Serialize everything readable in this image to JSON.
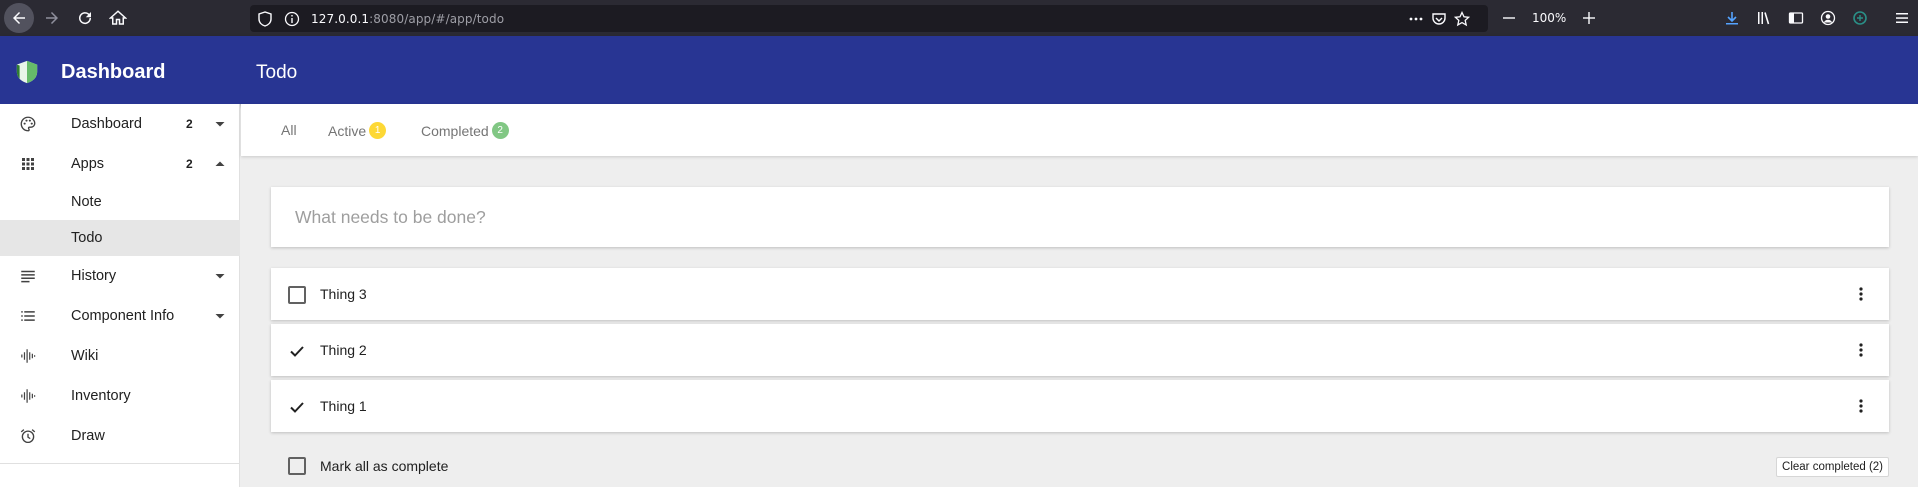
{
  "browser": {
    "url_host": "127.0.0.1",
    "url_rest": ":8080/app/#/app/todo",
    "zoom": "100%"
  },
  "appbar": {
    "brand": "Dashboard",
    "title": "Todo",
    "color": "#283593"
  },
  "sidebar": {
    "items": [
      {
        "label": "Dashboard",
        "badge": "2",
        "icon": "palette-icon",
        "caret": "down"
      },
      {
        "label": "Apps",
        "badge": "2",
        "icon": "apps-grid-icon",
        "caret": "up"
      },
      {
        "label": "Note"
      },
      {
        "label": "Todo"
      },
      {
        "label": "History",
        "icon": "notes-icon",
        "caret": "down"
      },
      {
        "label": "Component Info",
        "icon": "list-icon",
        "caret": "down"
      },
      {
        "label": "Wiki",
        "icon": "waveform-icon"
      },
      {
        "label": "Inventory",
        "icon": "waveform-icon"
      },
      {
        "label": "Draw",
        "icon": "alarm-icon"
      }
    ]
  },
  "tabs": {
    "all": "All",
    "active": "Active",
    "active_count": "1",
    "completed": "Completed",
    "completed_count": "2"
  },
  "new_todo": {
    "placeholder": "What needs to be done?"
  },
  "todos": [
    {
      "text": "Thing 3",
      "done": false
    },
    {
      "text": "Thing 2",
      "done": true
    },
    {
      "text": "Thing 1",
      "done": true
    }
  ],
  "footer": {
    "mark_all": "Mark all as complete",
    "clear_completed": "Clear completed (2)"
  }
}
